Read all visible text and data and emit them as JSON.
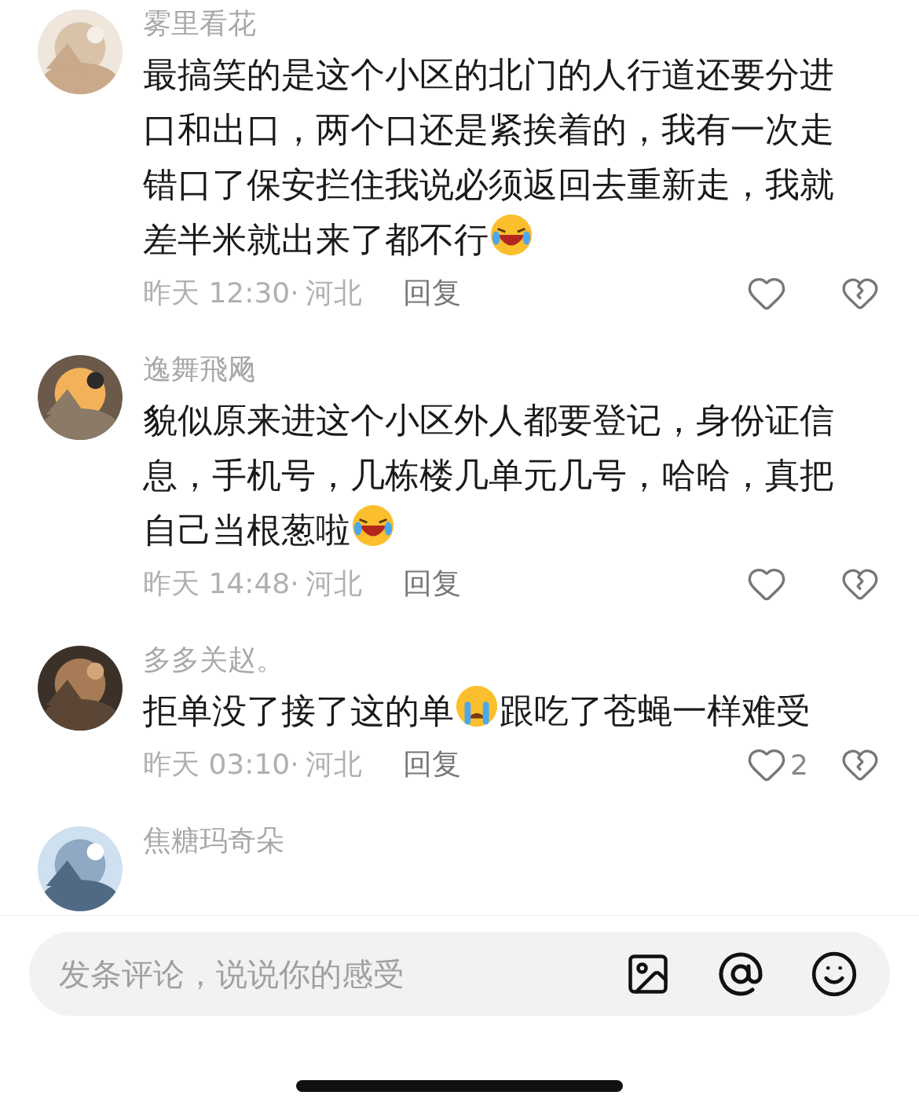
{
  "comments": [
    {
      "name": "雾里看花",
      "body": [
        {
          "kind": "text",
          "text": "最搞笑的是这个小区的北门的人行道还要分进口和出口，两个口还是紧挨着的，我有一次走错口了保安拦住我说必须返回去重新走，我就差半米就出来了都不行"
        },
        {
          "kind": "emoji-laugh-cry"
        }
      ],
      "time": "昨天 12:30·",
      "location": "河北",
      "reply": "回复"
    },
    {
      "name": "逸舞飛飏",
      "body": [
        {
          "kind": "text",
          "text": "貌似原来进这个小区外人都要登记，身份证信息，手机号，几栋楼几单元几号，哈哈，真把自己当根葱啦"
        },
        {
          "kind": "emoji-laugh-cry"
        }
      ],
      "time": "昨天 14:48·",
      "location": "河北",
      "reply": "回复"
    },
    {
      "name": "多多关赵。",
      "body": [
        {
          "kind": "text",
          "text": "拒单没了接了这的单"
        },
        {
          "kind": "emoji-crying"
        },
        {
          "kind": "text",
          "text": "跟吃了苍蝇一样难受"
        }
      ],
      "time": "昨天 03:10·",
      "location": "河北",
      "reply": "回复",
      "likes": "2"
    },
    {
      "name": "焦糖玛奇朵"
    }
  ],
  "composer": {
    "placeholder": "发条评论，说说你的感受"
  }
}
